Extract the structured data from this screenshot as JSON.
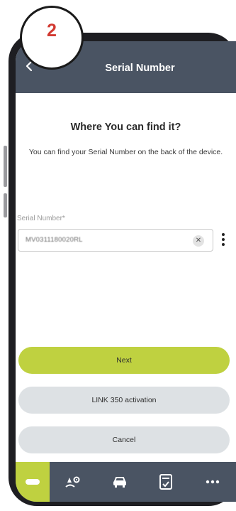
{
  "step_number": "2",
  "header": {
    "title": "Serial Number"
  },
  "content": {
    "title": "Where You can find it?",
    "description": "You can find your Serial Number on the back of the device."
  },
  "serial_field": {
    "label": "Serial Number*",
    "value": "MV0311180020RL",
    "clear_glyph": "✕"
  },
  "buttons": {
    "next": "Next",
    "link_activation": "LINK 350 activation",
    "cancel": "Cancel"
  },
  "colors": {
    "header_bg": "#4a5463",
    "accent_green": "#bfd140",
    "secondary_button": "#dde1e4",
    "badge_number": "#d23a32"
  },
  "tab_bar": {
    "tabs": [
      {
        "icon": "device-icon",
        "active": true
      },
      {
        "icon": "location-settings-icon",
        "active": false
      },
      {
        "icon": "car-icon",
        "active": false
      },
      {
        "icon": "checklist-icon",
        "active": false
      },
      {
        "icon": "more-icon",
        "active": false
      }
    ]
  }
}
